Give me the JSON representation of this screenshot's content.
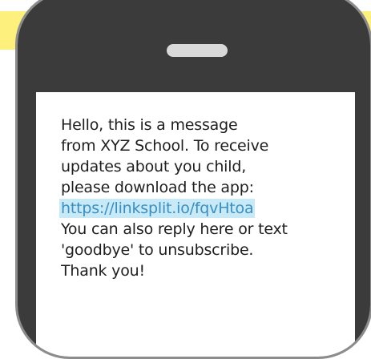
{
  "message": {
    "line_1": "Hello, this is a message",
    "line_2": "from XYZ School. To receive",
    "line_3": "updates about you child,",
    "line_4": "please download the app:",
    "link": "https://linksplit.io/fqvHtoa",
    "line_6": "You can also reply here or text",
    "line_7": "'goodbye' to unsubscribe.",
    "line_8": "Thank you!"
  },
  "colors": {
    "banner": "#fdf07c",
    "phone_body": "#3b3b3b",
    "phone_frame": "#d7d7d7",
    "screen": "#ffffff",
    "link_highlight": "#c8eaf7",
    "link_text": "#3a8ec2"
  }
}
